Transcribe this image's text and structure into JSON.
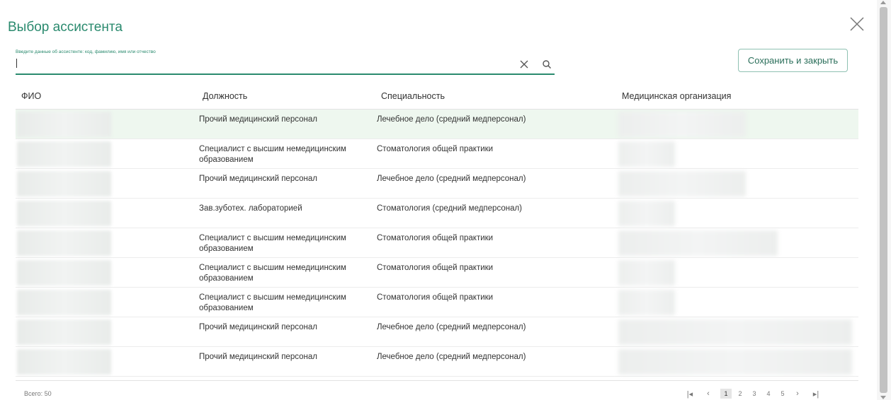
{
  "dialog": {
    "title": "Выбор ассистента",
    "save_label": "Сохранить и закрыть"
  },
  "search": {
    "label": "Введите данные об ассистенте: код, фамилию, имя или отчество",
    "value": "",
    "icons": {
      "clear": "close-icon",
      "search": "search-icon"
    }
  },
  "table": {
    "columns": [
      "ФИО",
      "Должность",
      "Специальность",
      "Медицинская организация"
    ],
    "rows": [
      {
        "position": "Прочий медицинский персонал",
        "specialty": "Лечебное дело (средний медперсонал)",
        "selected": true
      },
      {
        "position": "Специалист с высшим немедицинским образованием",
        "specialty": "Стоматология общей практики"
      },
      {
        "position": "Прочий медицинский персонал",
        "specialty": "Лечебное дело (средний медперсонал)"
      },
      {
        "position": "Зав.зуботех. лабораторией",
        "specialty": "Стоматология (средний медперсонал)"
      },
      {
        "position": "Специалист с высшим немедицинским образованием",
        "specialty": "Стоматология общей практики"
      },
      {
        "position": "Специалист с высшим немедицинским образованием",
        "specialty": "Стоматология общей практики"
      },
      {
        "position": "Специалист с высшим немедицинским образованием",
        "specialty": "Стоматология общей практики"
      },
      {
        "position": "Прочий медицинский персонал",
        "specialty": "Лечебное дело (средний медперсонал)"
      },
      {
        "position": "Прочий медицинский персонал",
        "specialty": "Лечебное дело (средний медперсонал)"
      }
    ]
  },
  "footer": {
    "total": "Всего: 50",
    "pages": [
      "1",
      "2",
      "3",
      "4",
      "5"
    ],
    "current_page": "1",
    "nav": {
      "first": "|◂",
      "prev": "‹",
      "next": "›",
      "last": "▸|"
    }
  },
  "colors": {
    "accent": "#2a8a6e",
    "selected_row": "#eef7ef"
  }
}
